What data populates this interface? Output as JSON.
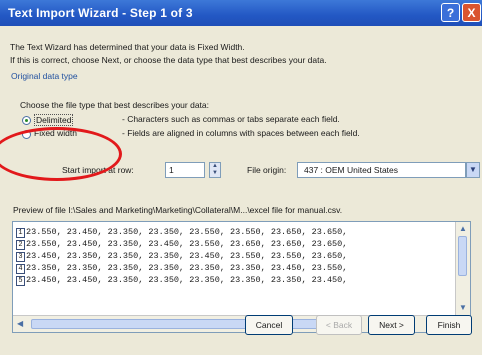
{
  "window": {
    "title": "Text Import Wizard - Step 1 of 3",
    "help_glyph": "?",
    "close_glyph": "X"
  },
  "intro": {
    "line1": "The Text Wizard has determined that your data is Fixed Width.",
    "line2": "If this is correct, choose Next, or choose the data type that best describes your data."
  },
  "original_data_type": {
    "group_label": "Original data type",
    "choose_text": "Choose the file type that best describes your data:",
    "options": [
      {
        "label": "Delimited",
        "desc": "- Characters such as commas or tabs separate each field.",
        "selected": true
      },
      {
        "label": "Fixed width",
        "desc": "- Fields are aligned in columns with spaces between each field.",
        "selected": false
      }
    ]
  },
  "import": {
    "start_label": "Start import at row:",
    "start_value": "1",
    "file_origin_label": "File origin:",
    "file_origin_value": "437 : OEM United States"
  },
  "preview": {
    "label": "Preview of file I:\\Sales and Marketing\\Marketing\\Collateral\\M...\\excel file for manual.csv.",
    "rows": [
      {
        "num": "1",
        "text": "23.550, 23.450, 23.350, 23.350, 23.550, 23.550, 23.650, 23.650,"
      },
      {
        "num": "2",
        "text": "23.550, 23.450, 23.350, 23.450, 23.550, 23.650, 23.650, 23.650,"
      },
      {
        "num": "3",
        "text": "23.450, 23.350, 23.350, 23.350, 23.450, 23.550, 23.550, 23.650,"
      },
      {
        "num": "4",
        "text": "23.350, 23.350, 23.350, 23.350, 23.350, 23.350, 23.450, 23.550,"
      },
      {
        "num": "5",
        "text": "23.450, 23.450, 23.350, 23.350, 23.350, 23.350, 23.350, 23.450,"
      }
    ]
  },
  "buttons": {
    "cancel": "Cancel",
    "back": "< Back",
    "next": "Next >",
    "finish": "Finish"
  },
  "colors": {
    "title_bar": "#2358c4",
    "dialog_bg": "#ece9d8",
    "group_label": "#1f4f9f",
    "annotation_circle": "#e2191b"
  }
}
